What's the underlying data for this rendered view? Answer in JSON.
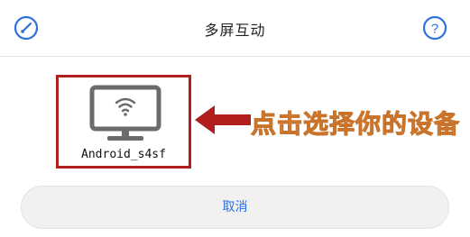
{
  "dialog": {
    "title": "多屏互动",
    "left_icon": "cast-icon",
    "right_icon": "help-icon",
    "help_glyph": "?"
  },
  "device": {
    "icon": "tv-wifi-icon",
    "name": "Android_s4sf"
  },
  "annotation": {
    "text": "点击选择你的设备",
    "color": "#f4b879",
    "highlight_color": "#b01e1e"
  },
  "cancel": {
    "label": "取消",
    "color": "#2f6fe0"
  },
  "colors": {
    "accent": "#2f6fe0",
    "icon_gray": "#6b6b6b"
  }
}
